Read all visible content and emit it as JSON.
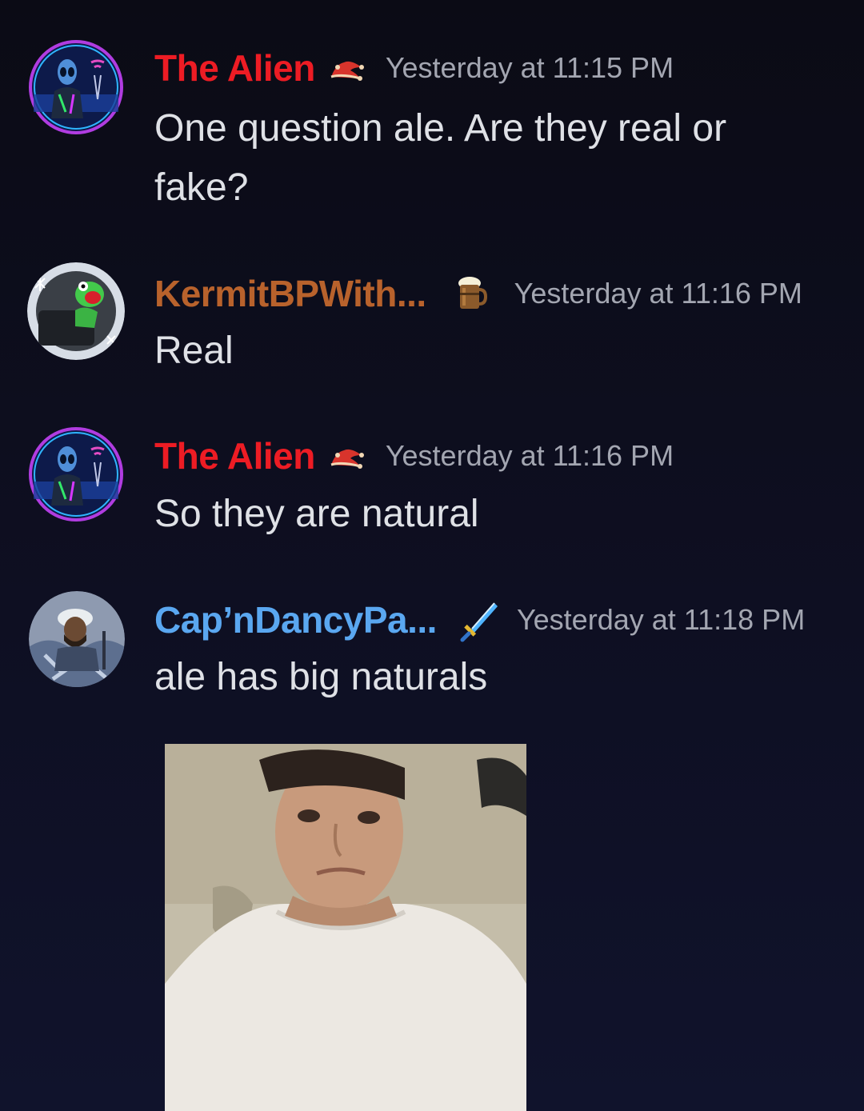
{
  "messages": [
    {
      "username": "The Alien",
      "username_color": "#ed1c24",
      "badge_icon": "jester-hat-icon",
      "timestamp": "Yesterday at 11:15 PM",
      "content": "One question ale. Are they real or fake?"
    },
    {
      "username": "KermitBPWith...",
      "username_color": "#b8622c",
      "badge_icon": "beer-mug-icon",
      "timestamp": "Yesterday at 11:16 PM",
      "content": "Real"
    },
    {
      "username": "The Alien",
      "username_color": "#ed1c24",
      "badge_icon": "jester-hat-icon",
      "timestamp": "Yesterday at 11:16 PM",
      "content": "So they are natural"
    },
    {
      "username": "Cap’nDancyPa...",
      "username_color": "#5aa7f0",
      "badge_icon": "sword-icon",
      "timestamp": "Yesterday at 11:18 PM",
      "content": "ale has big naturals"
    }
  ],
  "colors": {
    "background": "#0b0b15",
    "timestamp": "#a3a6b1",
    "message_text": "#dfe1e6"
  }
}
